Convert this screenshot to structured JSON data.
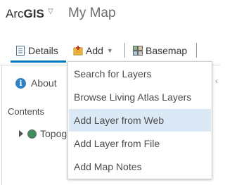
{
  "header": {
    "brand_light": "Arc",
    "brand_bold": "GIS",
    "brand_caret": "▽",
    "map_title": "My Map"
  },
  "toolbar": {
    "details_label": "Details",
    "add_label": "Add",
    "basemap_label": "Basemap",
    "active_tab": "Details",
    "accent_color": "#0079c1"
  },
  "panel": {
    "about_label": "About",
    "contents_label": "Contents",
    "layer_label": "Topog"
  },
  "add_menu": {
    "items": [
      {
        "label": "Search for Layers"
      },
      {
        "label": "Browse Living Atlas Layers"
      },
      {
        "label": "Add Layer from Web",
        "highlighted": true
      },
      {
        "label": "Add Layer from File"
      },
      {
        "label": "Add Map Notes"
      }
    ],
    "highlight_color": "#dbe9f6"
  },
  "icons": {
    "details": "document-icon",
    "add": "add-layer-icon",
    "basemap": "basemap-grid-icon",
    "about": "info-icon",
    "layer": "globe-icon"
  }
}
